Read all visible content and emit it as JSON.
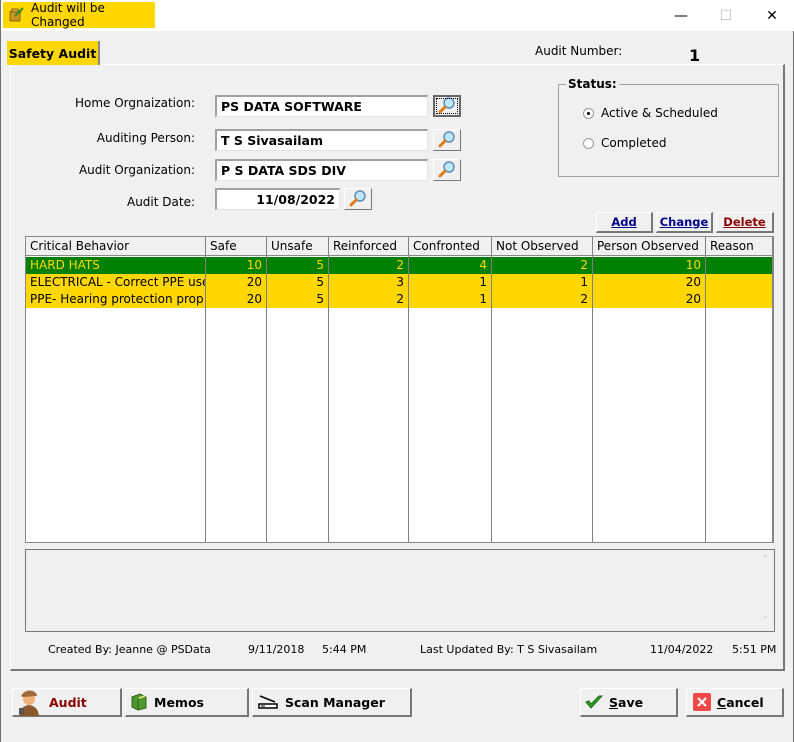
{
  "window": {
    "title": "Audit will be Changed",
    "minimize_glyph": "—",
    "maximize_glyph": "☐",
    "close_glyph": "✕",
    "title_icon": "audit-folder-icon"
  },
  "tab": {
    "label": "Safety Audit"
  },
  "audit_number": {
    "label": "Audit Number:",
    "value": "1"
  },
  "form": {
    "home_org": {
      "label": "Home Orgnaization:",
      "value": "PS DATA SOFTWARE"
    },
    "auditing_person": {
      "label": "Auditing Person:",
      "value": "T S Sivasailam"
    },
    "audit_org": {
      "label": "Audit Organization:",
      "value": "P S  DATA SDS DIV"
    },
    "audit_date": {
      "label": "Audit Date:",
      "value": "11/08/2022"
    }
  },
  "status": {
    "legend": "Status:",
    "options": [
      {
        "label": "Active & Scheduled",
        "checked": true
      },
      {
        "label": "Completed",
        "checked": false
      }
    ]
  },
  "grid_actions": {
    "add": "Add",
    "change": "Change",
    "delete": "Delete"
  },
  "grid": {
    "columns": [
      "Critical Behavior",
      "Safe",
      "Unsafe",
      "Reinforced",
      "Confronted",
      "Not Observed",
      "Person Observed",
      "Reason"
    ],
    "rows": [
      {
        "behavior": "HARD HATS",
        "safe": "10",
        "unsafe": "5",
        "reinforced": "2",
        "confronted": "4",
        "not_observed": "2",
        "person_observed": "10",
        "reason": "",
        "style": "green"
      },
      {
        "behavior": "ELECTRICAL - Correct PPE use",
        "safe": "20",
        "unsafe": "5",
        "reinforced": "3",
        "confronted": "1",
        "not_observed": "1",
        "person_observed": "20",
        "reason": "",
        "style": "yellow"
      },
      {
        "behavior": "PPE- Hearing protection prop",
        "safe": "20",
        "unsafe": "5",
        "reinforced": "2",
        "confronted": "1",
        "not_observed": "2",
        "person_observed": "20",
        "reason": "",
        "style": "yellow"
      }
    ]
  },
  "memo": {
    "value": "",
    "scroll_up": "˄",
    "scroll_down": "˅"
  },
  "footer": {
    "created_by": "Created By: Jeanne @ PSData",
    "created_date": "9/11/2018",
    "created_time": "5:44 PM",
    "updated_by": "Last Updated By: T S Sivasailam",
    "updated_date": "11/04/2022",
    "updated_time": "5:51 PM"
  },
  "buttons": {
    "audit": "Audit",
    "memos": "Memos",
    "scan_manager": "Scan Manager",
    "save_underline": "S",
    "save_rest": "ave",
    "cancel_underline": "C",
    "cancel_rest": "ancel"
  },
  "colors": {
    "highlight_yellow": "#ffd700",
    "row_green": "#008000",
    "audit_button_text": "#8b0000",
    "add_change_text": "#00008b",
    "delete_text": "#8b0000"
  }
}
